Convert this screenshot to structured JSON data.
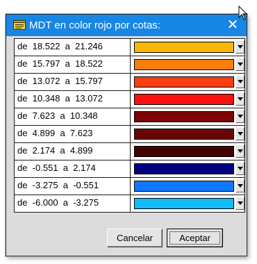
{
  "window": {
    "title": "MDT en color rojo por cotas:",
    "close_glyph": "✕",
    "title_icon": "notepad-icon"
  },
  "ranges": [
    {
      "label": "de  18.522  a  21.246",
      "color": "#f9b70a"
    },
    {
      "label": "de  15.797  a  18.522",
      "color": "#fb7d0d"
    },
    {
      "label": "de  13.072  a  15.797",
      "color": "#fb3f10"
    },
    {
      "label": "de  10.348  a  13.072",
      "color": "#fb1010"
    },
    {
      "label": "de  7.623  a  10.348",
      "color": "#7d0404"
    },
    {
      "label": "de  4.899  a  7.623",
      "color": "#6a0404"
    },
    {
      "label": "de  2.174  a  4.899",
      "color": "#400303"
    },
    {
      "label": "de  -0.551  a  2.174",
      "color": "#04007d"
    },
    {
      "label": "de  -3.275  a  -0.551",
      "color": "#1079fb"
    },
    {
      "label": "de  -6.000  a  -3.275",
      "color": "#12bcf8"
    }
  ],
  "buttons": {
    "cancel": "Cancelar",
    "accept": "Aceptar"
  }
}
